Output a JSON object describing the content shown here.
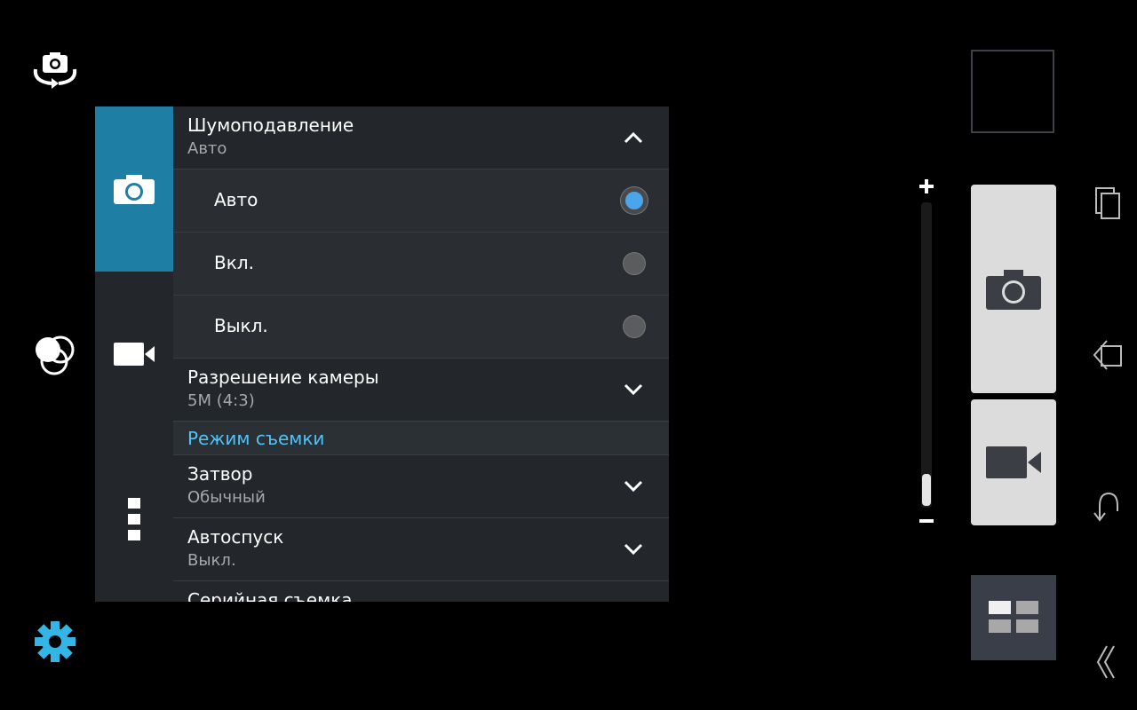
{
  "icons": {
    "switch_camera": "switch-camera-icon",
    "filters": "color-filter-icon",
    "settings": "gear-icon",
    "photo_tab": "camera-icon",
    "video_tab": "video-camera-icon",
    "more_tab": "more-vert-icon"
  },
  "colors": {
    "accent": "#1f7ea4",
    "section_text": "#4fc3f7",
    "settings_icon": "#33b5e5",
    "radio_selected": "#4aa6e8"
  },
  "settings": {
    "noise_reduction": {
      "title": "Шумоподавление",
      "value": "Авто",
      "options": [
        {
          "label": "Авто",
          "selected": true
        },
        {
          "label": "Вкл.",
          "selected": false
        },
        {
          "label": "Выкл.",
          "selected": false
        }
      ]
    },
    "resolution": {
      "title": "Разрешение камеры",
      "value": "5M (4:3)"
    },
    "section_shooting_mode": "Режим съемки",
    "shutter": {
      "title": "Затвор",
      "value": "Обычный"
    },
    "self_timer": {
      "title": "Автоспуск",
      "value": "Выкл."
    },
    "burst": {
      "title": "Серийная съемка"
    }
  },
  "zoom": {
    "plus": "+",
    "minus": "−",
    "level": 0.1
  }
}
